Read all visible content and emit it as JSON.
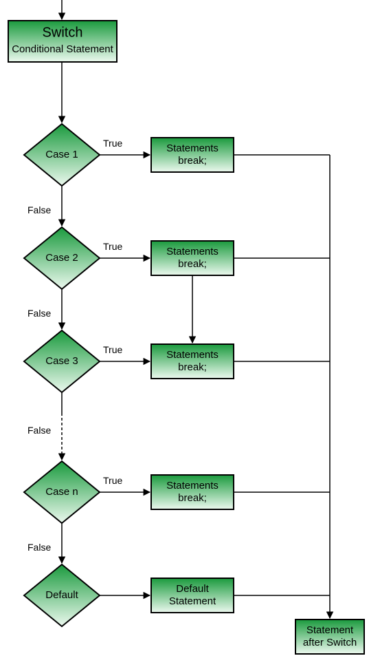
{
  "switch": {
    "title": "Switch",
    "subtitle": "Conditional Statement"
  },
  "cases": [
    {
      "label": "Case 1",
      "trueLabel": "True",
      "falseLabel": "False",
      "stmt1": "Statements",
      "stmt2": "break;"
    },
    {
      "label": "Case 2",
      "trueLabel": "True",
      "falseLabel": "False",
      "stmt1": "Statements",
      "stmt2": "break;"
    },
    {
      "label": "Case 3",
      "trueLabel": "True",
      "falseLabel": "False",
      "stmt1": "Statements",
      "stmt2": "break;"
    },
    {
      "label": "Case n",
      "trueLabel": "True",
      "falseLabel": "False",
      "stmt1": "Statements",
      "stmt2": "break;"
    }
  ],
  "default": {
    "label": "Default",
    "stmt1": "Default",
    "stmt2": "Statement"
  },
  "after": {
    "line1": "Statement",
    "line2": "after Switch"
  }
}
